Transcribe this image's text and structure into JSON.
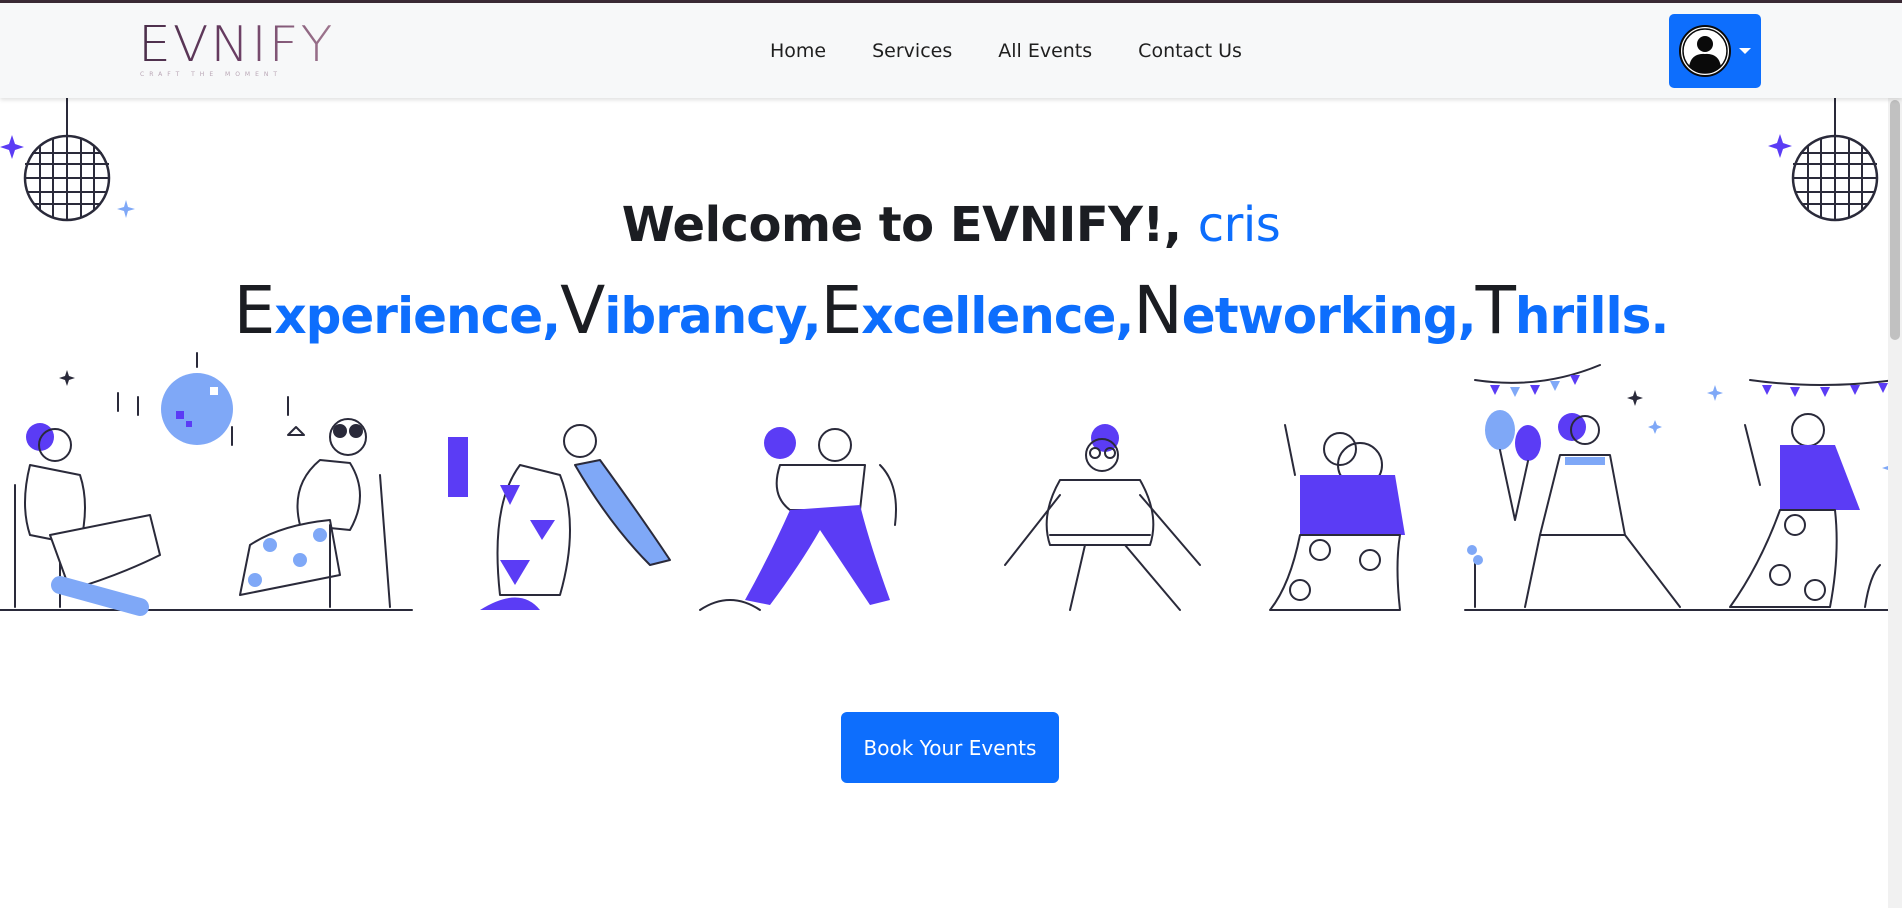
{
  "brand": {
    "logo_text": "EVNIFY",
    "tagline": "CRAFT THE MOMENT"
  },
  "nav": {
    "links": [
      {
        "label": "Home"
      },
      {
        "label": "Services"
      },
      {
        "label": "All Events"
      },
      {
        "label": "Contact Us"
      }
    ]
  },
  "hero": {
    "welcome_prefix": "Welcome to EVNIFY!,",
    "username": "cris",
    "tagline_parts": [
      {
        "cap": "E",
        "rest": "xperience,"
      },
      {
        "cap": "V",
        "rest": "ibrancy,"
      },
      {
        "cap": "E",
        "rest": "xcellence,"
      },
      {
        "cap": "N",
        "rest": "etworking,"
      },
      {
        "cap": "T",
        "rest": "hrills."
      }
    ]
  },
  "cta": {
    "label": "Book Your Events"
  },
  "icons": {
    "user": "user-avatar-icon",
    "dropdown": "caret-down-icon",
    "disco": "disco-ball-icon",
    "sparkle": "sparkle-icon"
  },
  "colors": {
    "primary": "#0d6efd",
    "accent_purple": "#5b3cf5",
    "light_blue": "#7fa8f7",
    "text_dark": "#1b1d22"
  }
}
